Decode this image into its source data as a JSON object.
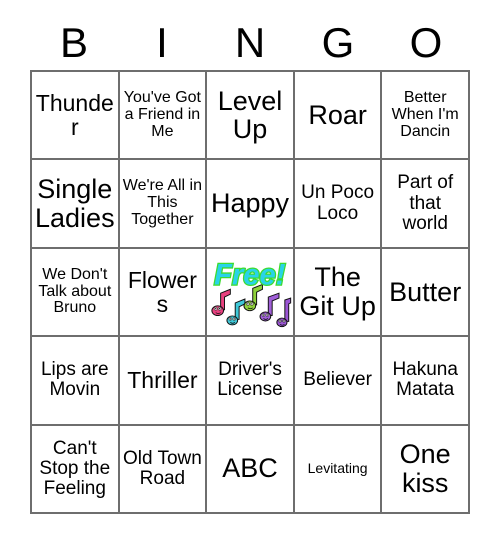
{
  "card": {
    "header_letters": [
      "B",
      "I",
      "N",
      "G",
      "O"
    ],
    "free_space": {
      "label": "Free!",
      "text_fill_color": "#29d3e8",
      "text_outline_color": "#3ddb2e",
      "note_colors": [
        "#e8417f",
        "#3fc8d8",
        "#8fd13a",
        "#a05fd8",
        "#9b55d4"
      ],
      "icon": "music-notes"
    },
    "rows": [
      [
        {
          "text": "Thunder",
          "size": "fs-lg"
        },
        {
          "text": "You've Got a Friend in Me",
          "size": "fs-sm"
        },
        {
          "text": "Level Up",
          "size": "fs-xl"
        },
        {
          "text": "Roar",
          "size": "fs-xl"
        },
        {
          "text": "Better When I'm Dancin",
          "size": "fs-sm"
        }
      ],
      [
        {
          "text": "Single Ladies",
          "size": "fs-xl"
        },
        {
          "text": "We're All in This Together",
          "size": "fs-sm"
        },
        {
          "text": "Happy",
          "size": "fs-xl"
        },
        {
          "text": "Un Poco Loco",
          "size": "fs-md"
        },
        {
          "text": "Part of that world",
          "size": "fs-md"
        }
      ],
      [
        {
          "text": "We Don't Talk about Bruno",
          "size": "fs-sm"
        },
        {
          "text": "Flowers",
          "size": "fs-lg"
        },
        {
          "text": "Free!",
          "size": "free"
        },
        {
          "text": "The Git Up",
          "size": "fs-xl"
        },
        {
          "text": "Butter",
          "size": "fs-xl"
        }
      ],
      [
        {
          "text": "Lips are Movin",
          "size": "fs-md"
        },
        {
          "text": "Thriller",
          "size": "fs-lg"
        },
        {
          "text": "Driver's License",
          "size": "fs-md"
        },
        {
          "text": "Believer",
          "size": "fs-md"
        },
        {
          "text": "Hakuna Matata",
          "size": "fs-md"
        }
      ],
      [
        {
          "text": "Can't Stop the Feeling",
          "size": "fs-md"
        },
        {
          "text": "Old Town Road",
          "size": "fs-md"
        },
        {
          "text": "ABC",
          "size": "fs-xl"
        },
        {
          "text": "Levitating",
          "size": "fs-xs"
        },
        {
          "text": "One kiss",
          "size": "fs-xl"
        }
      ]
    ]
  }
}
